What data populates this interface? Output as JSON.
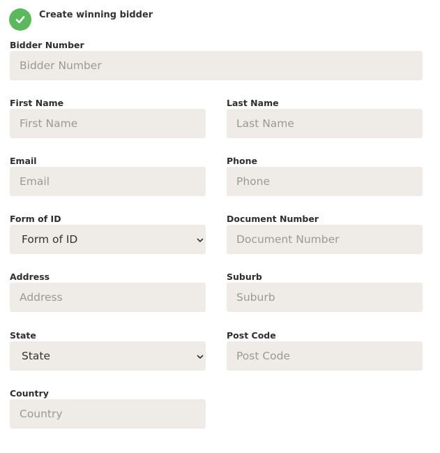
{
  "header": {
    "title": "Create winning bidder",
    "icon": "check-icon",
    "icon_color": "#5cb85c"
  },
  "fields": {
    "bidder_number": {
      "label": "Bidder Number",
      "placeholder": "Bidder Number"
    },
    "first_name": {
      "label": "First Name",
      "placeholder": "First Name"
    },
    "last_name": {
      "label": "Last Name",
      "placeholder": "Last Name"
    },
    "email": {
      "label": "Email",
      "placeholder": "Email"
    },
    "phone": {
      "label": "Phone",
      "placeholder": "Phone"
    },
    "form_of_id": {
      "label": "Form of ID",
      "selected": "Form of ID"
    },
    "document_number": {
      "label": "Document Number",
      "placeholder": "Document Number"
    },
    "address": {
      "label": "Address",
      "placeholder": "Address"
    },
    "suburb": {
      "label": "Suburb",
      "placeholder": "Suburb"
    },
    "state": {
      "label": "State",
      "selected": "State"
    },
    "post_code": {
      "label": "Post Code",
      "placeholder": "Post Code"
    },
    "country": {
      "label": "Country",
      "placeholder": "Country"
    }
  }
}
